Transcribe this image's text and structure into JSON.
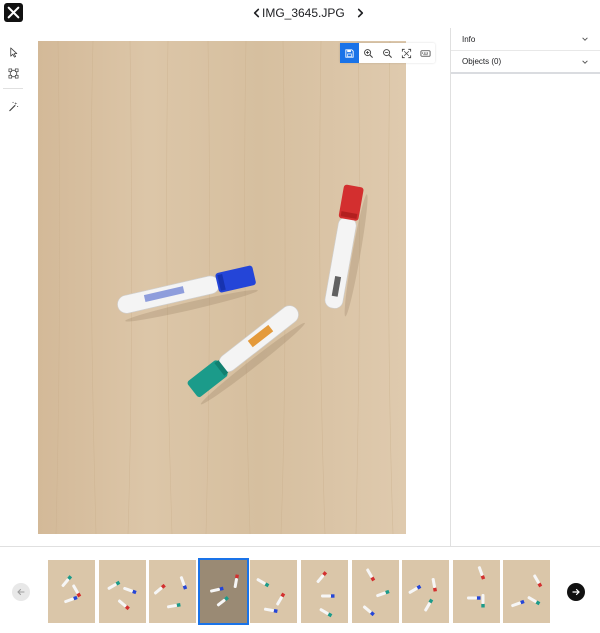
{
  "header": {
    "title": "IMG_3645.JPG"
  },
  "icons": {
    "close": "close-icon",
    "prev": "chevron-left-icon",
    "next": "chevron-right-icon"
  },
  "toolbar": {
    "tools": [
      "cursor-icon",
      "bounding-box-icon",
      "magic-wand-icon"
    ]
  },
  "image_toolbar": {
    "tools": [
      "save-icon",
      "zoom-in-icon",
      "zoom-out-icon",
      "fit-screen-icon",
      "keyboard-icon"
    ]
  },
  "right_panel": {
    "info_label": "Info",
    "objects_label": "Objects (0)"
  },
  "filmstrip": {
    "selected_index": 3,
    "thumb_count": 10
  },
  "colors": {
    "accent": "#1a73e8",
    "marker_red": "#d32f2f",
    "marker_blue": "#2445d8",
    "marker_green": "#1b9b8a",
    "wood": "#d9c2a4"
  }
}
